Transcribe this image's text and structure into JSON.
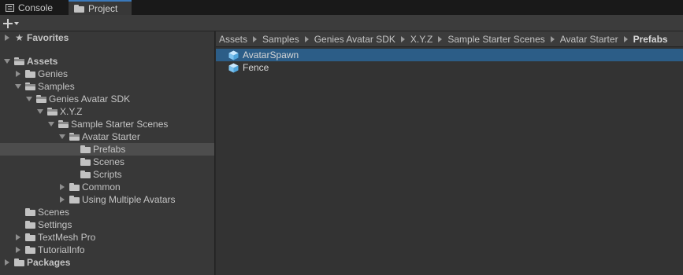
{
  "tabs": [
    {
      "label": "Console",
      "icon": "console-icon",
      "active": false
    },
    {
      "label": "Project",
      "icon": "folder-icon",
      "active": true
    }
  ],
  "toolbar": {
    "create_icon": "plus-icon"
  },
  "tree": {
    "favorites": "Favorites",
    "assets": "Assets",
    "genies": "Genies",
    "samples": "Samples",
    "genies_avatar_sdk": "Genies Avatar SDK",
    "xyz": "X.Y.Z",
    "sample_starter_scenes": "Sample Starter Scenes",
    "avatar_starter": "Avatar Starter",
    "prefabs": "Prefabs",
    "scenes_inner": "Scenes",
    "scripts": "Scripts",
    "common": "Common",
    "using_multiple_avatars": "Using Multiple Avatars",
    "scenes": "Scenes",
    "settings": "Settings",
    "textmesh_pro": "TextMesh Pro",
    "tutorial_info": "TutorialInfo",
    "packages": "Packages"
  },
  "breadcrumb": [
    "Assets",
    "Samples",
    "Genies Avatar SDK",
    "X.Y.Z",
    "Sample Starter Scenes",
    "Avatar Starter",
    "Prefabs"
  ],
  "assets": [
    {
      "label": "AvatarSpawn",
      "icon": "prefab-cube-icon",
      "selected": true
    },
    {
      "label": "Fence",
      "icon": "prefab-cube-icon",
      "selected": false
    }
  ],
  "colors": {
    "selection": "#2c5d87",
    "tab_accent": "#3a79bb",
    "prefab_icon": "#7fc4f0"
  }
}
